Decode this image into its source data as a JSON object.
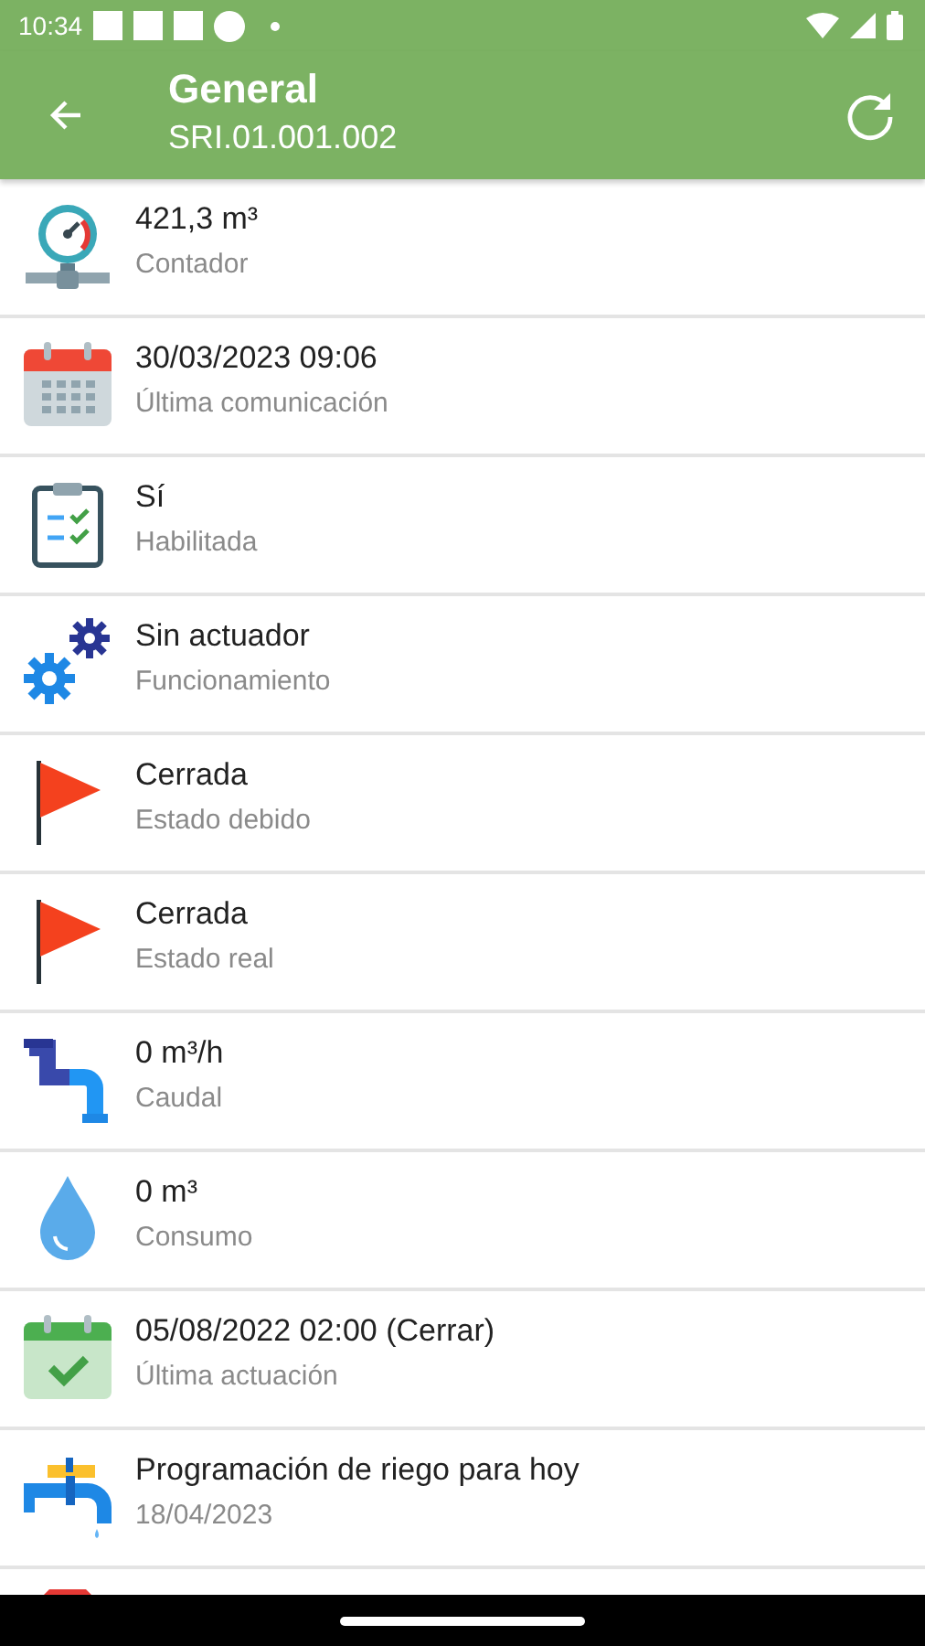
{
  "status_bar": {
    "time": "10:34"
  },
  "app_bar": {
    "title": "General",
    "subtitle": "SRI.01.001.002"
  },
  "items": [
    {
      "kind": "meter",
      "value": "421,3 m³",
      "label": "Contador"
    },
    {
      "kind": "calendar",
      "value": "30/03/2023 09:06",
      "label": "Última comunicación"
    },
    {
      "kind": "checklist",
      "value": "Sí",
      "label": "Habilitada"
    },
    {
      "kind": "gears",
      "value": "Sin actuador",
      "label": "Funcionamiento"
    },
    {
      "kind": "flag",
      "value": "Cerrada",
      "label": "Estado debido"
    },
    {
      "kind": "flag",
      "value": "Cerrada",
      "label": "Estado real"
    },
    {
      "kind": "pipe",
      "value": "0 m³/h",
      "label": "Caudal"
    },
    {
      "kind": "drop",
      "value": "0 m³",
      "label": "Consumo"
    },
    {
      "kind": "calendar-check",
      "value": "05/08/2022 02:00 (Cerrar)",
      "label": "Última actuación"
    },
    {
      "kind": "faucet",
      "value": "Programación de riego para hoy",
      "label": "18/04/2023"
    },
    {
      "kind": "stop"
    }
  ]
}
